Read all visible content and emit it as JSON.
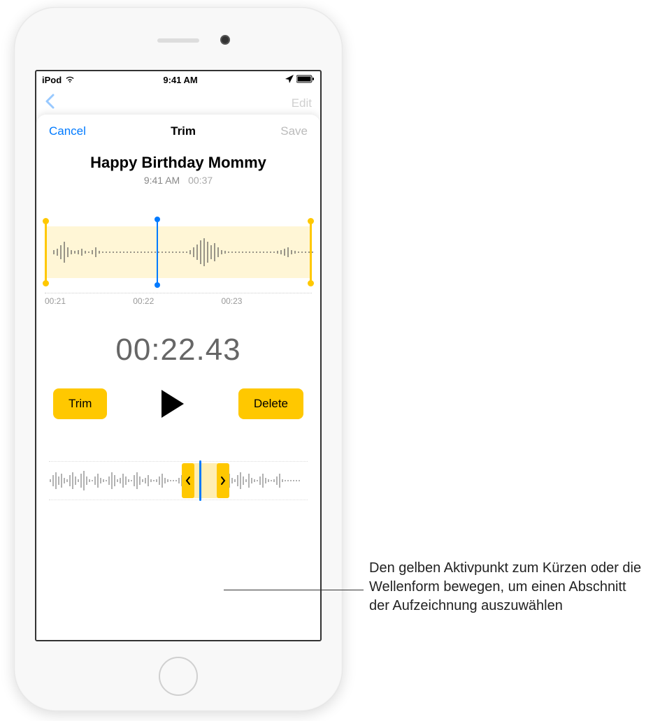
{
  "status_bar": {
    "carrier": "iPod",
    "time": "9:41 AM"
  },
  "background": {
    "edit_label": "Edit"
  },
  "modal": {
    "cancel_label": "Cancel",
    "title": "Trim",
    "save_label": "Save"
  },
  "recording": {
    "title": "Happy Birthday Mommy",
    "time": "9:41 AM",
    "duration": "00:37"
  },
  "ruler": {
    "t0": "00:21",
    "t1": "00:22",
    "t2": "00:23"
  },
  "timecode": "00:22.43",
  "controls": {
    "trim": "Trim",
    "delete": "Delete"
  },
  "callout": {
    "text": "Den gelben Aktivpunkt zum Kürzen oder die Wellenform bewegen, um einen Abschnitt der Aufzeichnung auszuwählen"
  }
}
